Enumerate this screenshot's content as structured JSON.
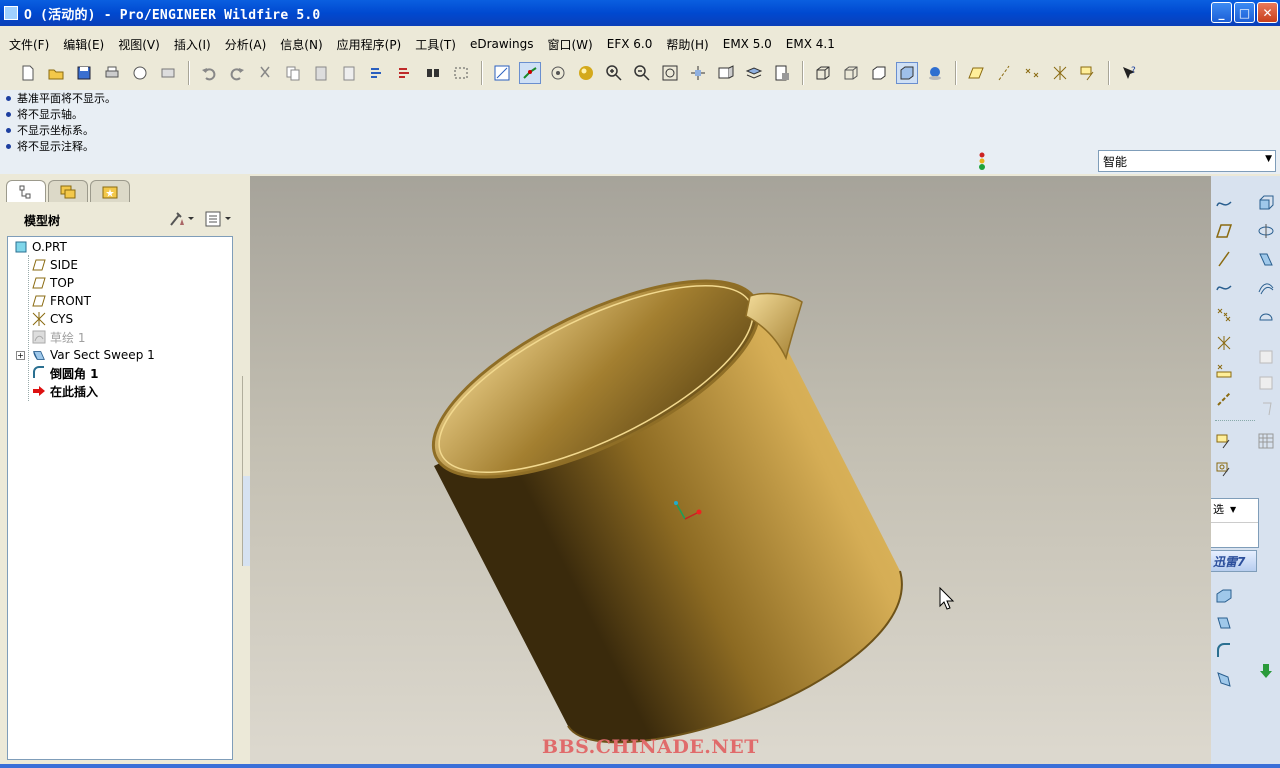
{
  "window": {
    "title": "O (活动的) - Pro/ENGINEER Wildfire 5.0",
    "min_label": "_",
    "max_label": "□",
    "close_label": "✕"
  },
  "menu": [
    {
      "label": "文件(F)"
    },
    {
      "label": "编辑(E)"
    },
    {
      "label": "视图(V)"
    },
    {
      "label": "插入(I)"
    },
    {
      "label": "分析(A)"
    },
    {
      "label": "信息(N)"
    },
    {
      "label": "应用程序(P)"
    },
    {
      "label": "工具(T)"
    },
    {
      "label": "eDrawings"
    },
    {
      "label": "窗口(W)"
    },
    {
      "label": "EFX 6.0"
    },
    {
      "label": "帮助(H)"
    },
    {
      "label": "EMX 5.0"
    },
    {
      "label": "EMX 4.1"
    }
  ],
  "messages": [
    "基准平面将不显示。",
    "将不显示轴。",
    "不显示坐标系。",
    "将不显示注释。"
  ],
  "filter_select": {
    "value": "智能"
  },
  "model_tree": {
    "header": "模型树",
    "items": [
      {
        "label": "O.PRT",
        "icon": "part-icon",
        "indent": 0,
        "dim": false
      },
      {
        "label": "SIDE",
        "icon": "datum-plane-icon",
        "indent": 1,
        "dim": false
      },
      {
        "label": "TOP",
        "icon": "datum-plane-icon",
        "indent": 1,
        "dim": false
      },
      {
        "label": "FRONT",
        "icon": "datum-plane-icon",
        "indent": 1,
        "dim": false
      },
      {
        "label": "CYS",
        "icon": "coordinate-system-icon",
        "indent": 1,
        "dim": false
      },
      {
        "label": "草绘 1",
        "icon": "sketch-icon",
        "indent": 1,
        "dim": true
      },
      {
        "label": "Var Sect Sweep 1",
        "icon": "sweep-icon",
        "indent": 1,
        "dim": false,
        "expandable": true
      },
      {
        "label": "倒圆角 1",
        "icon": "round-icon",
        "indent": 1,
        "dim": false
      },
      {
        "label": "在此插入",
        "icon": "insert-here-arrow-icon",
        "indent": 1,
        "dim": false
      }
    ]
  },
  "right_panel": {
    "filter_label": "选",
    "promo_label": "迅雷7"
  },
  "watermark": "BBS.CHINADE.NET",
  "colors": {
    "titlebar": "#0a5fe0",
    "model_gold": "#c9a24a",
    "watermark": "#e06b6b"
  }
}
